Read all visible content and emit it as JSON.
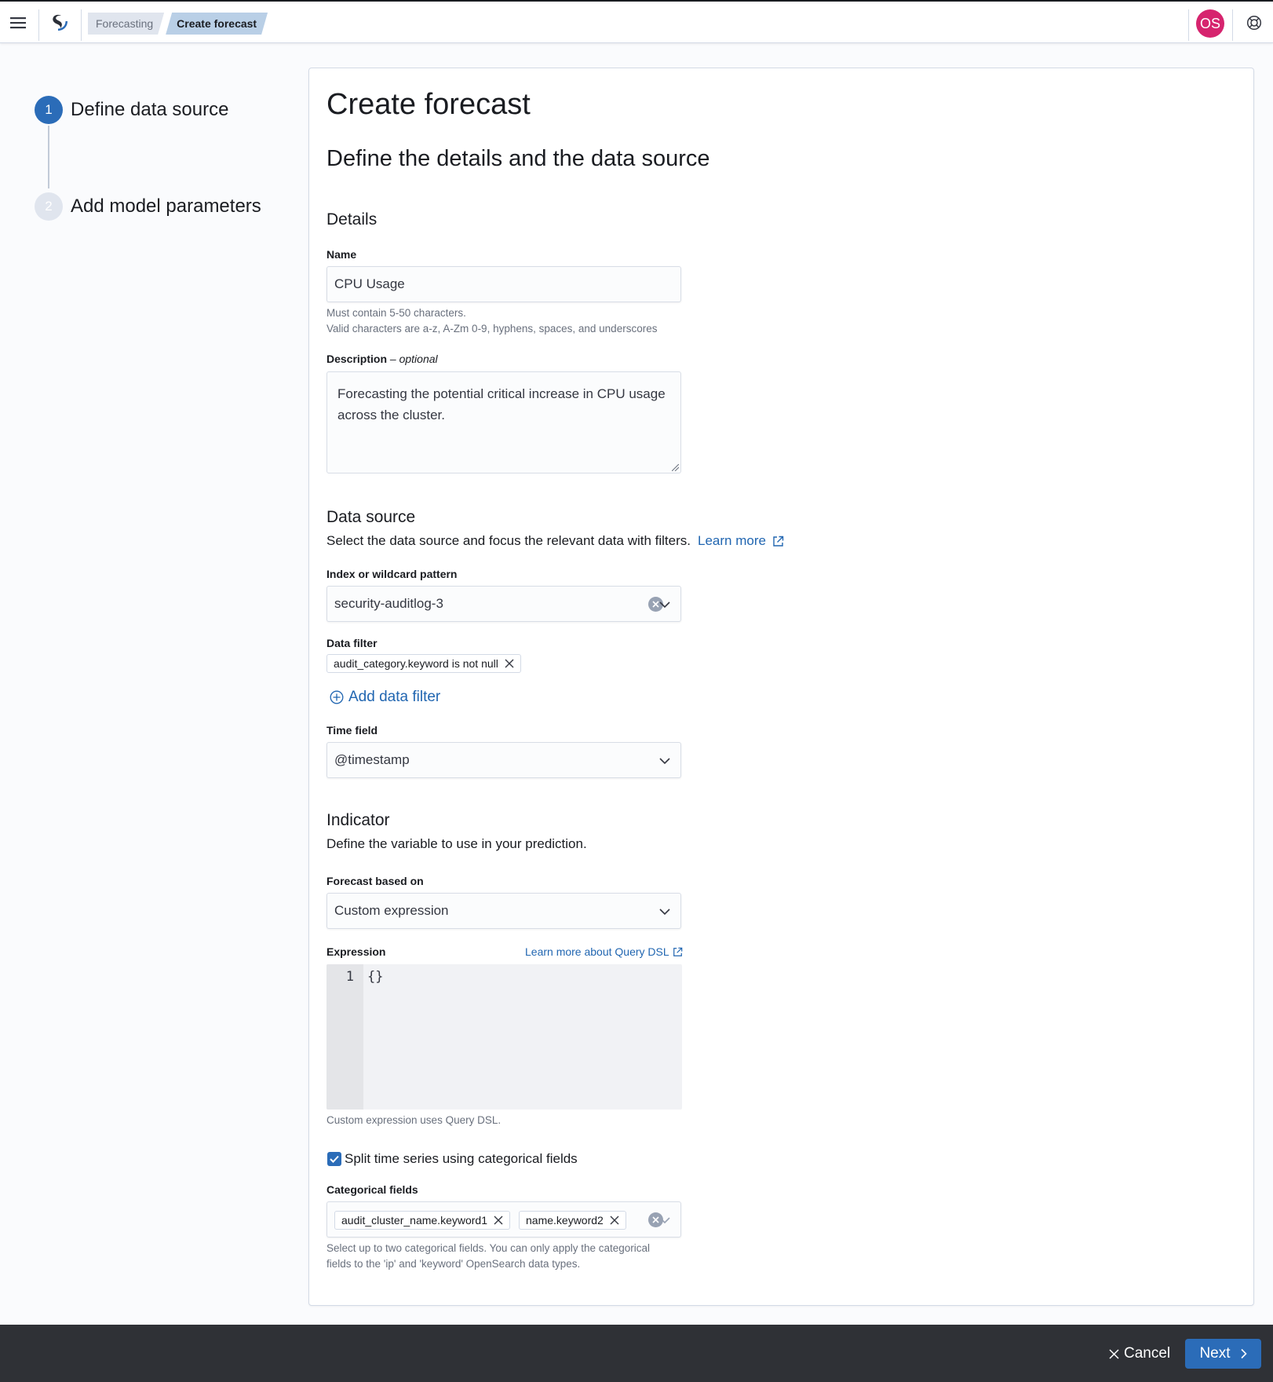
{
  "header": {
    "menu_icon": "hamburger-menu-icon",
    "logo_icon": "opensearch-logo-icon",
    "breadcrumbs": [
      "Forecasting",
      "Create forecast"
    ],
    "avatar_initials": "OS",
    "help_icon": "help-lifebuoy-icon"
  },
  "steps": [
    {
      "number": "1",
      "label": "Define data source",
      "active": true
    },
    {
      "number": "2",
      "label": "Add model parameters",
      "active": false
    }
  ],
  "page": {
    "title": "Create forecast",
    "subtitle": "Define the details and the data source"
  },
  "details": {
    "title": "Details",
    "name_label": "Name",
    "name_value": "CPU Usage",
    "name_help_1": "Must contain 5-50 characters.",
    "name_help_2": "Valid characters are a-z, A-Zm 0-9, hyphens, spaces, and underscores",
    "description_label": "Description",
    "description_optional": "– optional",
    "description_value": "Forecasting the potential critical increase in CPU usage across the cluster."
  },
  "data_source": {
    "title": "Data source",
    "description": "Select the data source and focus the relevant data with filters.",
    "learn_more": "Learn more",
    "index_label": "Index or wildcard pattern",
    "index_value": "security-auditlog-3",
    "data_filter_label": "Data filter",
    "data_filter_chip": "audit_category.keyword is not null",
    "add_filter": "Add data filter",
    "time_field_label": "Time field",
    "time_field_value": "@timestamp"
  },
  "indicator": {
    "title": "Indicator",
    "description": "Define the variable to use in your prediction.",
    "forecast_based_on_label": "Forecast based on",
    "forecast_based_on_value": "Custom expression",
    "expression_label": "Expression",
    "expression_link": "Learn more about Query DSL",
    "code_line_number": "1",
    "code_text": "{}",
    "expression_help": "Custom expression uses Query DSL.",
    "split_checkbox_label": "Split time series using categorical fields",
    "split_checked": true,
    "categorical_label": "Categorical fields",
    "categorical_chips": [
      "audit_cluster_name.keyword1",
      "name.keyword2"
    ],
    "categorical_help_1": "Select up to two categorical fields. You can only apply the categorical",
    "categorical_help_2": "fields to the 'ip' and 'keyword' OpenSearch data types."
  },
  "footer": {
    "cancel": "Cancel",
    "next": "Next"
  },
  "colors": {
    "primary": "#2b6cb8",
    "link": "#2166b1",
    "avatar": "#d6246e",
    "bottom_bar": "#2f3136"
  }
}
